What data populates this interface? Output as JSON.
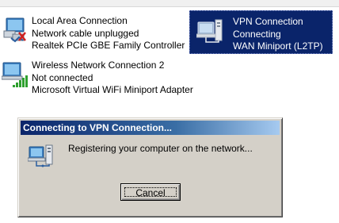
{
  "connections": [
    {
      "name": "Local Area Connection",
      "status": "Network cable unplugged",
      "device": "Realtek PCIe GBE Family Controller",
      "icon": "wired-network-disconnected-icon"
    },
    {
      "name": "Wireless Network Connection 2",
      "status": "Not connected",
      "device": "Microsoft Virtual WiFi Miniport Adapter",
      "icon": "wireless-network-icon"
    },
    {
      "name": "VPN Connection",
      "status": "Connecting",
      "device": "WAN Miniport (L2TP)",
      "icon": "vpn-network-icon",
      "selected": true
    }
  ],
  "dialog": {
    "title": "Connecting to VPN Connection...",
    "message": "Registering your computer on the network...",
    "cancel_label": "Cancel",
    "icon": "network-connecting-icon"
  },
  "colors": {
    "selection_bg": "#0a246a",
    "dialog_bg": "#d4d0c8",
    "title_gradient_start": "#0a246a",
    "title_gradient_end": "#a6caf0",
    "signal_green": "#2ea02e",
    "cable_red": "#d02020"
  }
}
